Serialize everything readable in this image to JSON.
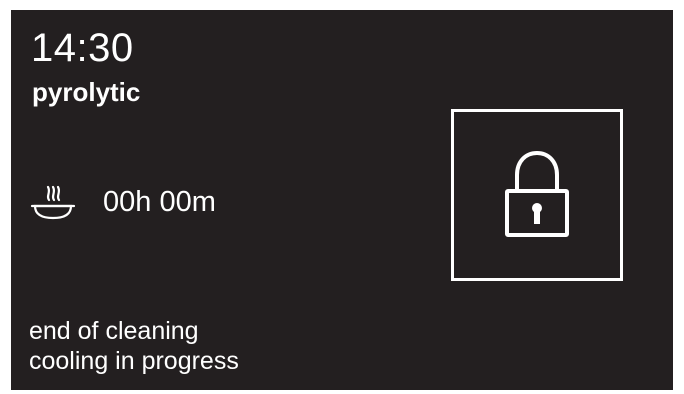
{
  "display": {
    "time": "14:30",
    "mode": "pyrolytic",
    "duration": "00h 00m",
    "status_lines": [
      "end of cleaning",
      "cooling in progress"
    ]
  },
  "icons": {
    "duration": "steaming-dish-icon",
    "door": "padlock-icon"
  },
  "colors": {
    "background": "#231f20",
    "foreground": "#ffffff"
  }
}
